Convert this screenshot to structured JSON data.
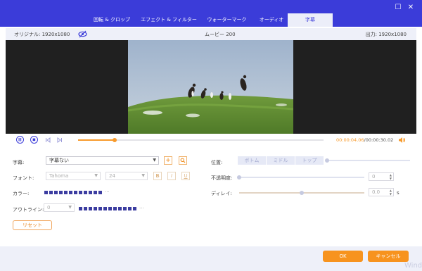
{
  "tabs": [
    {
      "label": "回転 & クロップ",
      "active": false
    },
    {
      "label": "エフェクト & フィルター",
      "active": false
    },
    {
      "label": "ウォーターマーク",
      "active": false
    },
    {
      "label": "オーディオ",
      "active": false
    },
    {
      "label": "字幕",
      "active": true
    }
  ],
  "window": {
    "minimize_glyph": "☐",
    "close_glyph": "✕"
  },
  "info": {
    "original": "オリジナル: 1920x1080",
    "title": "ムービー 200",
    "output": "出力: 1920x1080"
  },
  "player": {
    "current_time": "00:00:04.06",
    "total_time": "/00:00:30.02",
    "progress_fraction": 0.15
  },
  "subtitle": {
    "label": "字幕:",
    "value": "字幕ない",
    "add_glyph": "+",
    "search_glyph": "🔍"
  },
  "font": {
    "label": "フォント:",
    "family": "Tahoma",
    "size": "24",
    "bold": "B",
    "italic": "I",
    "underline": "U"
  },
  "color": {
    "label": "カラー:",
    "swatch_count": 12,
    "more": "···"
  },
  "outline": {
    "label": "アウトライン:",
    "value": "0",
    "swatch_count": 12,
    "more": "···"
  },
  "reset_label": "リセット",
  "position": {
    "label": "位置:",
    "options": [
      "ボトム",
      "ミドル",
      "トップ"
    ],
    "slider_fraction": 0.0
  },
  "opacity": {
    "label": "不透明度:",
    "value": "0",
    "slider_fraction": 0.0
  },
  "delay": {
    "label": "ディレイ:",
    "value": "0.0",
    "unit": "s",
    "slider_fraction": 0.5
  },
  "footer": {
    "ok": "OK",
    "cancel": "キャンセル"
  },
  "watermark_text": "Wind",
  "colors": {
    "accent": "#3b3cd9",
    "orange": "#f7931e",
    "swatch": "#3b3ca0"
  }
}
